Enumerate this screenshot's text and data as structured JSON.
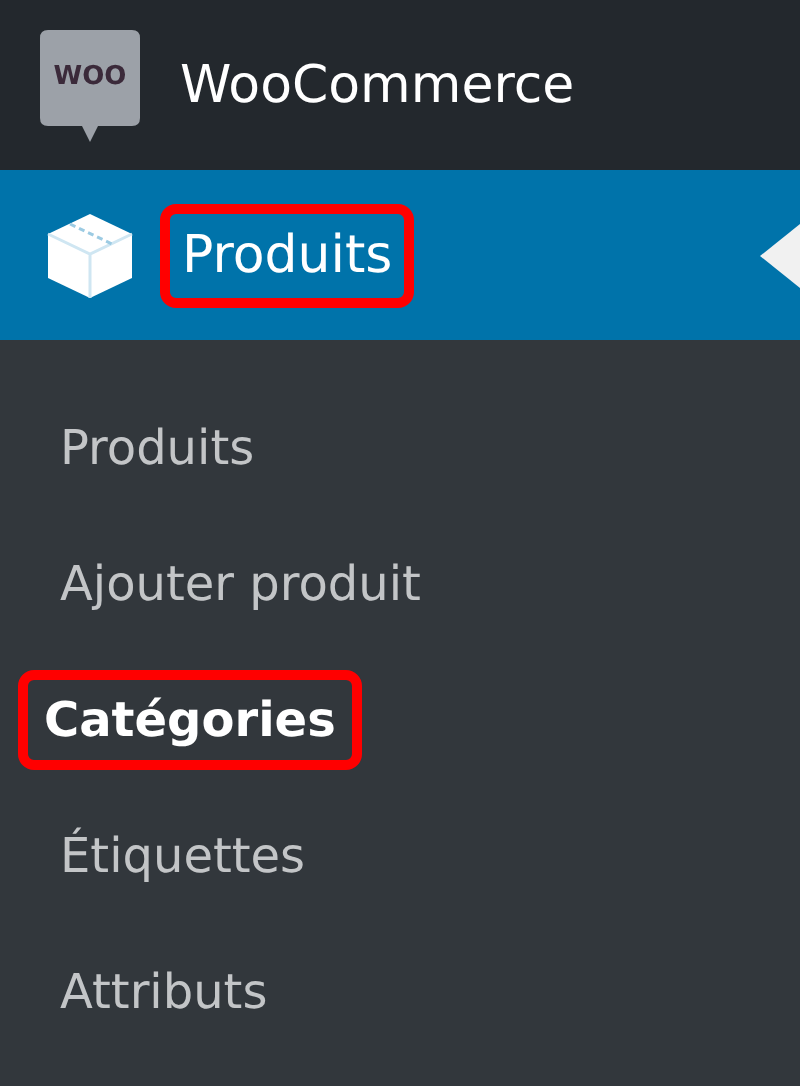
{
  "menu": [
    {
      "label": "WooCommerce",
      "kind": "woo",
      "logo_text": "WOO",
      "selected": false,
      "highlighted": false
    },
    {
      "label": "Produits",
      "kind": "box",
      "selected": true,
      "highlighted": true
    }
  ],
  "submenu": [
    {
      "label": "Produits",
      "selected": false,
      "highlighted": false
    },
    {
      "label": "Ajouter produit",
      "selected": false,
      "highlighted": false
    },
    {
      "label": "Catégories",
      "selected": true,
      "highlighted": true
    },
    {
      "label": "Étiquettes",
      "selected": false,
      "highlighted": false
    },
    {
      "label": "Attributs",
      "selected": false,
      "highlighted": false
    }
  ]
}
